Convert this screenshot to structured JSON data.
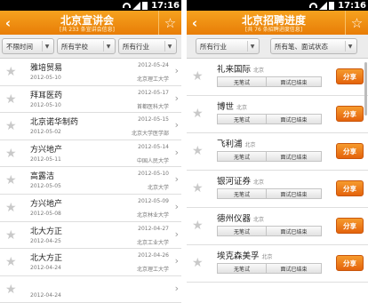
{
  "status": {
    "time": "17:16"
  },
  "left": {
    "title": "北京宣讲会",
    "subtitle": "[共 233 条宣讲会信息]",
    "filters": [
      "不限时间",
      "所有学校",
      "所有行业"
    ],
    "rows": [
      {
        "name": "雅培贸易",
        "date_top": "2012-05-24",
        "date_bottom": "2012-05-10",
        "university": "北京理工大学"
      },
      {
        "name": "拜耳医药",
        "date_top": "2012-05-17",
        "date_bottom": "2012-05-10",
        "university": "首都医科大学"
      },
      {
        "name": "北京诺华制药",
        "date_top": "2012-05-15",
        "date_bottom": "2012-05-02",
        "university": "北京大学医学部"
      },
      {
        "name": "方兴地产",
        "date_top": "2012-05-14",
        "date_bottom": "2012-05-11",
        "university": "中国人民大学"
      },
      {
        "name": "高露洁",
        "date_top": "2012-05-10",
        "date_bottom": "2012-05-05",
        "university": "北京大学"
      },
      {
        "name": "方兴地产",
        "date_top": "2012-05-09",
        "date_bottom": "2012-05-08",
        "university": "北京林业大学"
      },
      {
        "name": "北大方正",
        "date_top": "2012-04-27",
        "date_bottom": "2012-04-25",
        "university": "北京工业大学"
      },
      {
        "name": "北大方正",
        "date_top": "2012-04-26",
        "date_bottom": "2012-04-24",
        "university": "北京理工大学"
      },
      {
        "name": "",
        "date_top": "",
        "date_bottom": "2012-04-24",
        "university": ""
      }
    ]
  },
  "right": {
    "title": "北京招聘进度",
    "subtitle": "[共 76 条招聘进度信息]",
    "filters": [
      "所有行业",
      "所有笔、面试状态"
    ],
    "share_label": "分享",
    "rows": [
      {
        "name": "礼来国际",
        "city": "北京",
        "stage1": "无笔试",
        "stage2": "面试已结束"
      },
      {
        "name": "博世",
        "city": "北京",
        "stage1": "无笔试",
        "stage2": "面试已结束"
      },
      {
        "name": "飞利浦",
        "city": "北京",
        "stage1": "无笔试",
        "stage2": "面试已结束"
      },
      {
        "name": "银河证券",
        "city": "北京",
        "stage1": "无笔试",
        "stage2": "面试已结束"
      },
      {
        "name": "德州仪器",
        "city": "北京",
        "stage1": "无笔试",
        "stage2": "面试已结束"
      },
      {
        "name": "埃克森美孚",
        "city": "北京",
        "stage1": "无笔试",
        "stage2": "面试已结束"
      }
    ]
  }
}
